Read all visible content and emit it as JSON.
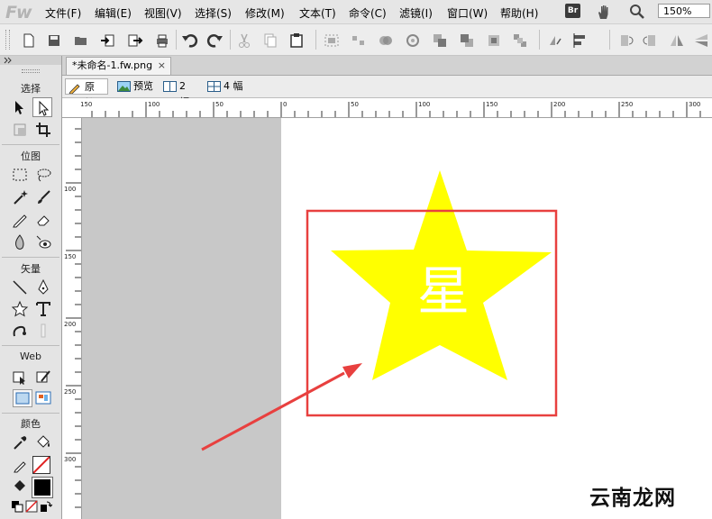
{
  "app": {
    "logo": "Fw"
  },
  "menu": [
    "文件(F)",
    "编辑(E)",
    "视图(V)",
    "选择(S)",
    "修改(M)",
    "文本(T)",
    "命令(C)",
    "滤镜(I)",
    "窗口(W)",
    "帮助(H)"
  ],
  "bridge_label": "Br",
  "zoom_level": "150%",
  "tools_panel": {
    "sections": [
      "选择",
      "位图",
      "矢量",
      "Web",
      "颜色"
    ]
  },
  "document": {
    "tab_title": "*未命名-1.fw.png",
    "close_glyph": "×"
  },
  "view_modes": [
    "原始",
    "预览",
    "2 幅",
    "4 幅"
  ],
  "rulers": {
    "horizontal_ticks": [
      "150",
      "100",
      "50",
      "0",
      "50",
      "100",
      "150",
      "200",
      "250",
      "300"
    ],
    "vertical_ticks": [
      "100",
      "150",
      "200",
      "250",
      "300"
    ]
  },
  "canvas": {
    "star_text": "星",
    "star_color": "#ffff00",
    "frame_color": "#e8403f",
    "arrow_color": "#e8403f"
  },
  "watermark": "云南龙网"
}
